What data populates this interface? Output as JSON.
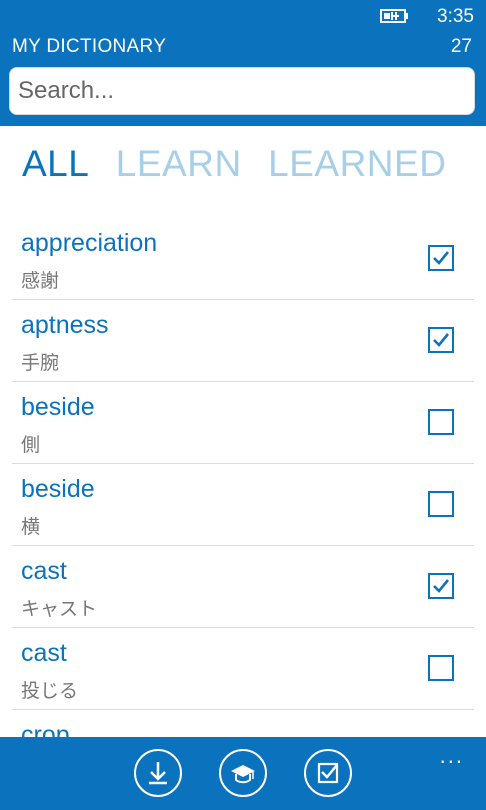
{
  "status": {
    "time": "3:35",
    "battery_icon": "battery-charging-icon"
  },
  "header": {
    "title": "MY DICTIONARY",
    "count": "27"
  },
  "search": {
    "placeholder": "Search..."
  },
  "tabs": [
    {
      "label": "ALL",
      "active": true
    },
    {
      "label": "LEARN",
      "active": false
    },
    {
      "label": "LEARNED",
      "active": false
    }
  ],
  "entries": [
    {
      "word": "appreciation",
      "translation": "感謝",
      "learned": true
    },
    {
      "word": "aptness",
      "translation": "手腕",
      "learned": true
    },
    {
      "word": "beside",
      "translation": "側",
      "learned": false
    },
    {
      "word": "beside",
      "translation": "横",
      "learned": false
    },
    {
      "word": "cast",
      "translation": "キャスト",
      "learned": true
    },
    {
      "word": "cast",
      "translation": "投じる",
      "learned": false
    },
    {
      "word": "crop",
      "translation": "",
      "learned": false
    }
  ],
  "appbar": {
    "buttons": [
      {
        "icon": "download-icon"
      },
      {
        "icon": "graduation-cap-icon"
      },
      {
        "icon": "checklist-icon"
      }
    ],
    "more": "..."
  },
  "colors": {
    "accent": "#0b73bd",
    "tab_inactive": "#a7cfe8"
  }
}
